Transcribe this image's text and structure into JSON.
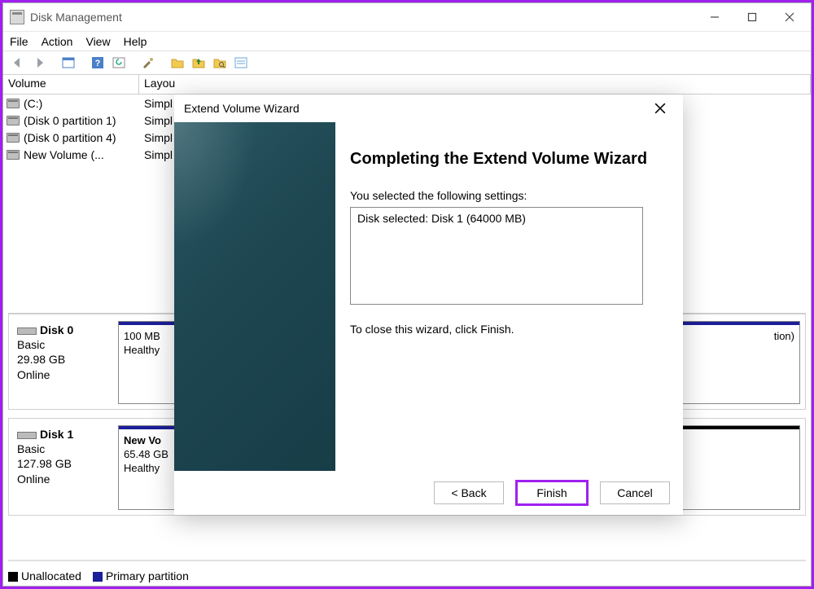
{
  "window": {
    "title": "Disk Management",
    "menus": [
      "File",
      "Action",
      "View",
      "Help"
    ],
    "min_tooltip": "Minimize",
    "max_tooltip": "Maximize",
    "close_tooltip": "Close"
  },
  "columns": {
    "volume": "Volume",
    "layout": "Layou"
  },
  "volumes": [
    {
      "name": "(C:)",
      "layout": "Simpl"
    },
    {
      "name": "(Disk 0 partition 1)",
      "layout": "Simpl"
    },
    {
      "name": "(Disk 0 partition 4)",
      "layout": "Simpl"
    },
    {
      "name": "New Volume (...",
      "layout": "Simpl"
    }
  ],
  "disks": [
    {
      "name": "Disk 0",
      "type": "Basic",
      "size": "29.98 GB",
      "status": "Online",
      "part1": {
        "size": "100 MB",
        "status": "Healthy"
      },
      "tail": "tion)"
    },
    {
      "name": "Disk 1",
      "type": "Basic",
      "size": "127.98 GB",
      "status": "Online",
      "part1": {
        "name": "New Vo",
        "size": "65.48 GB",
        "status": "Healthy"
      }
    }
  ],
  "legend": {
    "unallocated": "Unallocated",
    "primary": "Primary partition"
  },
  "wizard": {
    "title": "Extend Volume Wizard",
    "heading": "Completing the Extend Volume Wizard",
    "intro": "You selected the following settings:",
    "settings_text": "Disk selected: Disk 1 (64000 MB)",
    "close_text": "To close this wizard, click Finish.",
    "back": "< Back",
    "finish": "Finish",
    "cancel": "Cancel"
  }
}
